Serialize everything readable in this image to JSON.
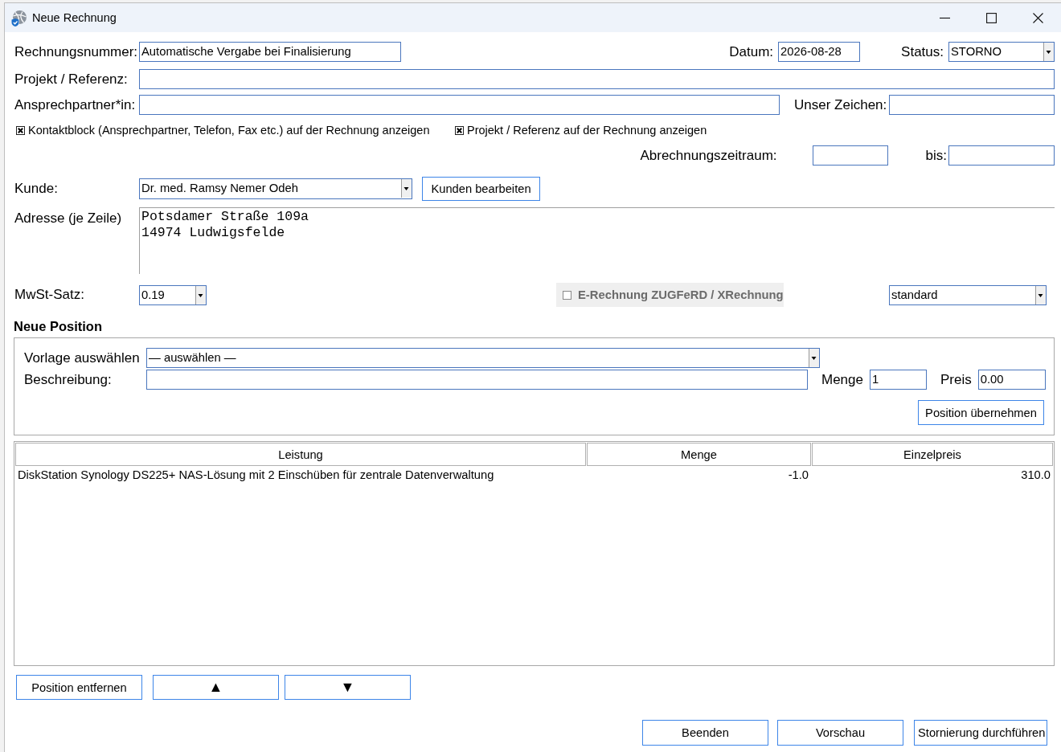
{
  "window": {
    "title": "Neue Rechnung"
  },
  "invoice": {
    "number": {
      "label": "Rechnungsnummer:",
      "value": "Automatische Vergabe bei Finalisierung"
    },
    "date": {
      "label": "Datum:",
      "value": "2026-08-28"
    },
    "status": {
      "label": "Status:",
      "value": "STORNO"
    },
    "project": {
      "label": "Projekt / Referenz:"
    },
    "contact": {
      "label": "Ansprechpartner*in:"
    },
    "our_reference": {
      "label": "Unser Zeichen:"
    },
    "options": [
      {
        "label": "Kontaktblock (Ansprechpartner, Telefon, Fax etc.) auf der Rechnung anzeigen",
        "checked": true
      },
      {
        "label": "Projekt / Referenz auf der Rechnung anzeigen",
        "checked": true
      }
    ],
    "billing_period": {
      "label": "Abrechnungszeitraum:",
      "to_label": "bis:"
    },
    "customer": {
      "label": "Kunde:",
      "value": "Dr. med. Ramsy Nemer Odeh",
      "button": "Kunden bearbeiten"
    },
    "address": {
      "label": "Adresse (je Zeile)",
      "lines": [
        "Potsdamer Straße 109a",
        "14974 Ludwigsfelde"
      ]
    },
    "vat": {
      "label": "MwSt-Satz:",
      "value": "0.19"
    },
    "e_invoice": {
      "label": "E-Rechnung ZUGFeRD / XRechnung",
      "checked": false,
      "disabled": true
    },
    "profile": {
      "value": "standard"
    }
  },
  "new_position": {
    "title": "Neue Position",
    "template": {
      "label": "Vorlage auswählen",
      "value": "— auswählen —"
    },
    "description": {
      "label": "Beschreibung:"
    },
    "quantity": {
      "label": "Menge",
      "value": "1"
    },
    "price": {
      "label": "Preis",
      "value": "0.00"
    },
    "button": "Position übernehmen"
  },
  "table": {
    "columns": [
      "Leistung",
      "Menge",
      "Einzelpreis"
    ],
    "rows": [
      {
        "cells": [
          "DiskStation Synology DS225+ NAS-Lösung mit 2 Einschüben für zentrale Datenverwaltung",
          "-1.0",
          "310.0"
        ],
        "selected": false
      }
    ]
  },
  "row_buttons": [
    {
      "kind": "text",
      "label": "Position entfernen"
    },
    {
      "kind": "arrow",
      "label": "▲"
    },
    {
      "kind": "arrow",
      "label": "▼"
    }
  ],
  "footer_buttons": [
    "Beenden",
    "Vorschau",
    "Stornierung durchführen"
  ]
}
